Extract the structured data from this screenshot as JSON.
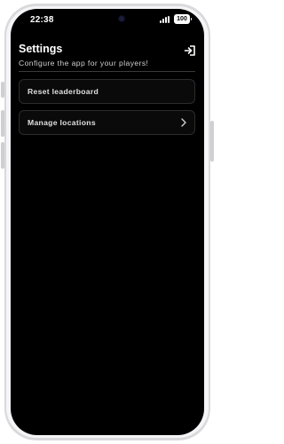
{
  "status_bar": {
    "time": "22:38",
    "battery_level": "100"
  },
  "header": {
    "title": "Settings",
    "subtitle": "Configure the app for your players!",
    "logout_icon": "logout-icon"
  },
  "settings": [
    {
      "label": "Reset leaderboard",
      "has_chevron": false
    },
    {
      "label": "Manage locations",
      "has_chevron": true,
      "icon": "chevron-right-icon"
    }
  ],
  "colors": {
    "background": "#000000",
    "text": "#ffffff",
    "row_border": "#2c2c2e"
  }
}
